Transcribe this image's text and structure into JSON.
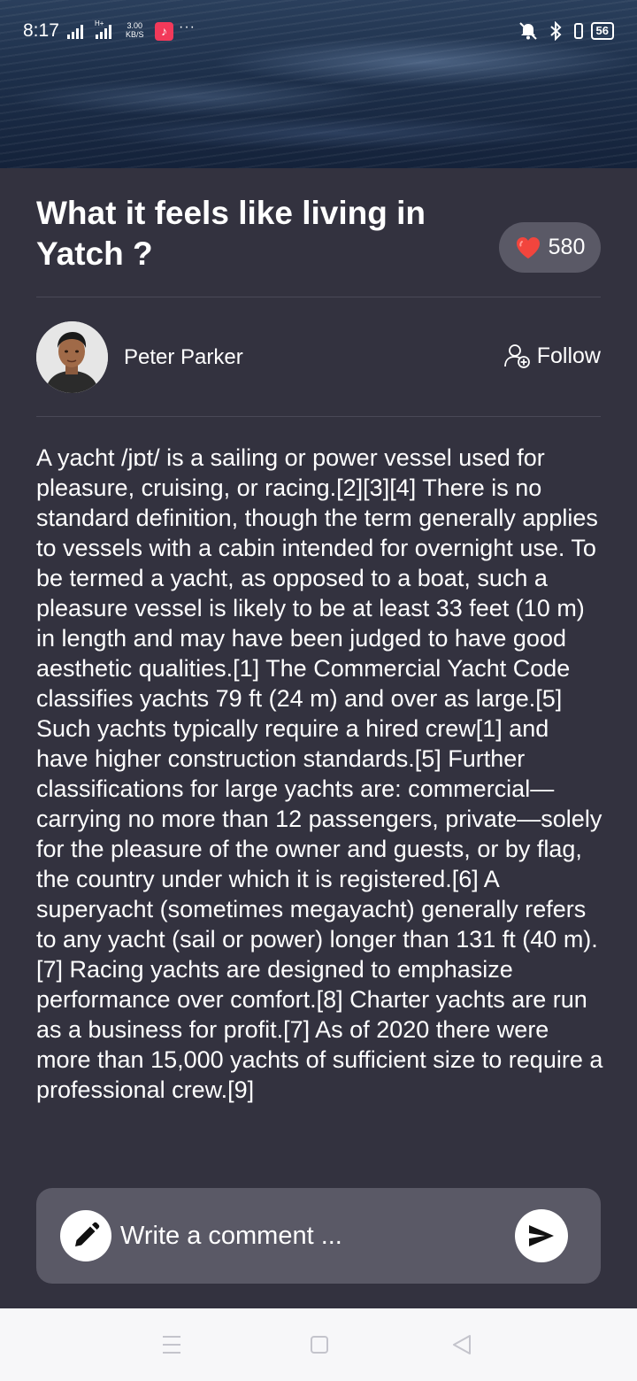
{
  "status_bar": {
    "time": "8:17",
    "speed_value": "3.00",
    "speed_unit": "KB/S",
    "more": "···",
    "battery": "56",
    "network_label": "H+"
  },
  "post": {
    "title": "What it feels like living in Yatch ?",
    "likes": "580",
    "author": {
      "name": "Peter Parker",
      "follow_label": "Follow"
    },
    "body": "A yacht /jɒt/ is a sailing or power vessel used for pleasure, cruising, or racing.[2][3][4] There is no standard definition, though the term generally applies to vessels with a cabin intended for overnight use. To be termed a yacht, as opposed to a boat, such a pleasure vessel is likely to be at least 33 feet (10 m) in length and may have been judged to have good aesthetic qualities.[1] The Commercial Yacht Code classifies yachts 79 ft (24 m) and over as large.[5] Such yachts typically require a hired crew[1] and have higher construction standards.[5] Further classifications for large yachts are: commercial—carrying no more than 12 passengers, private—solely for the pleasure of the owner and guests, or by flag, the country under which it is registered.[6] A superyacht (sometimes megayacht) generally refers to any yacht (sail or power) longer than 131 ft (40 m).[7] Racing yachts are designed to emphasize performance over comfort.[8] Charter yachts are run as a business for profit.[7] As of 2020 there were more than 15,000 yachts of sufficient size to require a professional crew.[9]"
  },
  "comment": {
    "placeholder": "Write a comment ..."
  },
  "icons": {
    "heart": "heart-icon",
    "follow": "add-person-icon",
    "pencil": "pencil-icon",
    "send": "send-icon",
    "nav_menu": "menu-icon",
    "nav_home": "square-icon",
    "nav_back": "back-triangle-icon"
  },
  "colors": {
    "background": "#33323f",
    "surface": "#5a5966",
    "heart": "#f2453d",
    "navbar": "#f7f7f9"
  }
}
